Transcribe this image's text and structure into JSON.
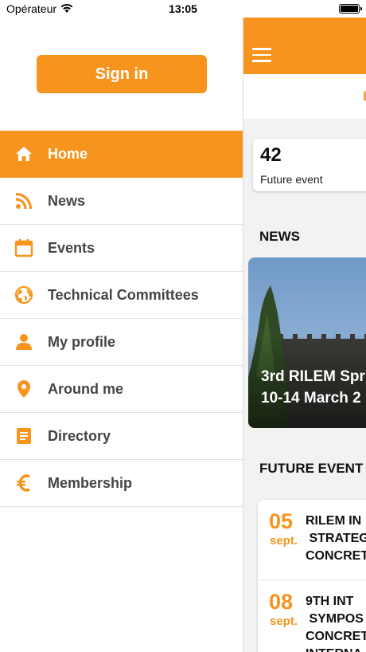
{
  "status_bar": {
    "carrier": "Opérateur",
    "time": "13:05"
  },
  "drawer": {
    "sign_in_label": "Sign in",
    "items": [
      {
        "label": "Home",
        "icon": "home-icon",
        "active": true
      },
      {
        "label": "News",
        "icon": "rss-icon",
        "active": false
      },
      {
        "label": "Events",
        "icon": "calendar-icon",
        "active": false
      },
      {
        "label": "Technical Committees",
        "icon": "globe-icon",
        "active": false
      },
      {
        "label": "My profile",
        "icon": "person-icon",
        "active": false
      },
      {
        "label": "Around me",
        "icon": "location-pin-icon",
        "active": false
      },
      {
        "label": "Directory",
        "icon": "document-icon",
        "active": false
      },
      {
        "label": "Membership",
        "icon": "euro-icon",
        "active": false
      }
    ]
  },
  "main": {
    "tab_partial": "L",
    "stat": {
      "value": "42",
      "label": "Future event"
    },
    "news_heading": "NEWS",
    "news_card": {
      "line1": "3rd RILEM Spr",
      "line2": "10-14 March 2"
    },
    "future_heading": "FUTURE EVENT",
    "events": [
      {
        "day": "05",
        "month": "sept.",
        "title": "RILEM IN\n STRATEG\nCONCRET"
      },
      {
        "day": "08",
        "month": "sept.",
        "title": "9TH INT\n SYMPOS\nCONCRET\nINTERNA"
      }
    ]
  },
  "colors": {
    "accent": "#f7941d",
    "text": "#444444"
  }
}
